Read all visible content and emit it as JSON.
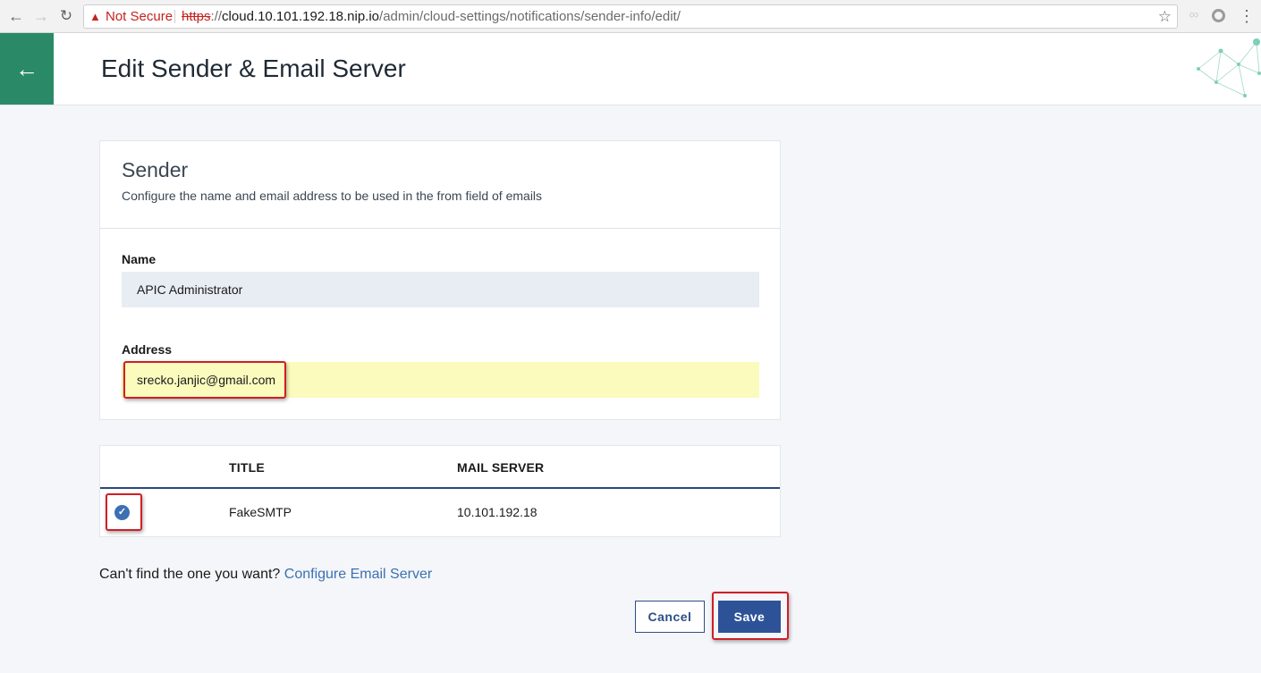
{
  "browser": {
    "security_label": "Not Secure",
    "url_scheme": "https",
    "url_sep": "://",
    "url_host": "cloud.10.101.192.18.nip.io",
    "url_path": "/admin/cloud-settings/notifications/sender-info/edit/"
  },
  "header": {
    "back_icon": "←",
    "title": "Edit Sender & Email Server"
  },
  "sender": {
    "title": "Sender",
    "description": "Configure the name and email address to be used in the from field of emails",
    "name_label": "Name",
    "name_value": "APIC Administrator",
    "address_label": "Address",
    "address_value": "srecko.janjic@gmail.com"
  },
  "table": {
    "columns": [
      "",
      "TITLE",
      "MAIL SERVER"
    ],
    "rows": [
      {
        "selected": true,
        "title": "FakeSMTP",
        "mail_server": "10.101.192.18"
      }
    ]
  },
  "footer": {
    "prompt": "Can't find the one you want?",
    "link": "Configure Email Server",
    "cancel": "Cancel",
    "save": "Save"
  },
  "colors": {
    "accent_green": "#2a8a68",
    "primary_blue": "#2d5297",
    "highlight_red": "#d11e26",
    "autofill_yellow": "#fafbbd"
  },
  "icons": {
    "back": "back-arrow-icon",
    "warning": "warning-icon",
    "star": "bookmark-star-icon",
    "radio": "checkmark-circle-icon"
  }
}
